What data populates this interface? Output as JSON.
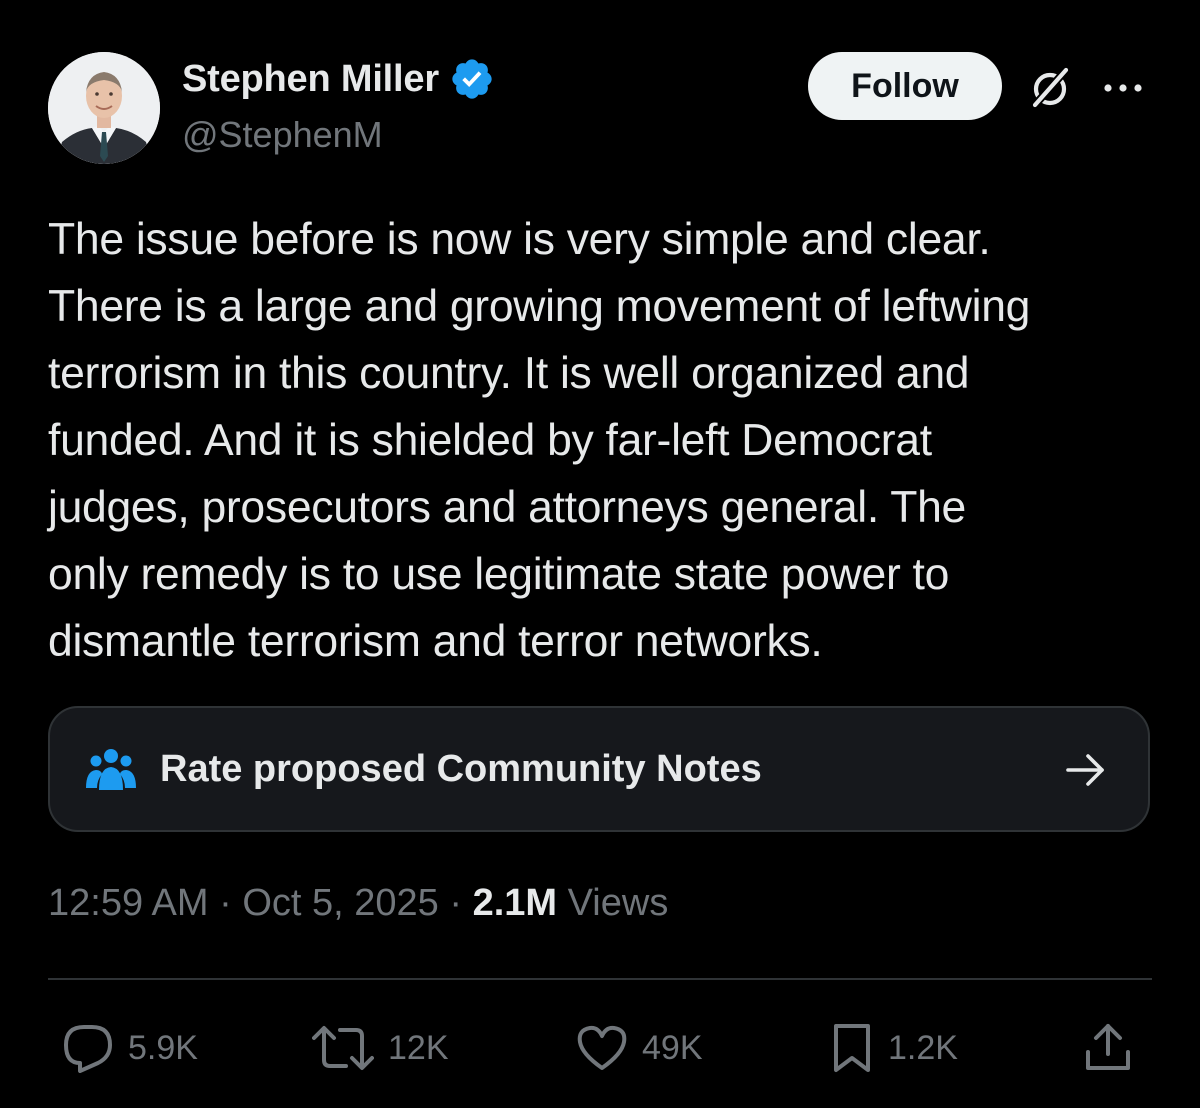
{
  "author": {
    "display_name": "Stephen Miller",
    "handle": "@StephenM",
    "verified": true,
    "verified_color": "#1d9bf0"
  },
  "header": {
    "follow_label": "Follow",
    "grok_icon": "grok-icon",
    "more_icon": "more-icon"
  },
  "tweet": {
    "text_lines": [
      "The issue before is now is very simple and clear.",
      "There is a large and growing movement of leftwing",
      "terrorism in this country. It is well organized and",
      "funded. And it is shielded by far-left Democrat",
      "judges, prosecutors and attorneys general. The",
      "only remedy is to use legitimate state power to",
      "dismantle terrorism and terror networks."
    ]
  },
  "community_notes": {
    "label": "Rate proposed Community Notes",
    "icon": "people-icon",
    "icon_color": "#1d9bf0"
  },
  "meta": {
    "time": "12:59 AM",
    "separator": "·",
    "date": "Oct 5, 2025",
    "views_count": "2.1M",
    "views_label": "Views"
  },
  "actions": {
    "reply": {
      "icon": "reply-icon",
      "count": "5.9K"
    },
    "retweet": {
      "icon": "retweet-icon",
      "count": "12K"
    },
    "like": {
      "icon": "heart-icon",
      "count": "49K"
    },
    "bookmark": {
      "icon": "bookmark-icon",
      "count": "1.2K"
    },
    "share": {
      "icon": "share-icon"
    }
  },
  "colors": {
    "background": "#000000",
    "text_primary": "#e7e9ea",
    "text_secondary": "#71767b",
    "border": "#2f3336",
    "accent": "#1d9bf0"
  }
}
